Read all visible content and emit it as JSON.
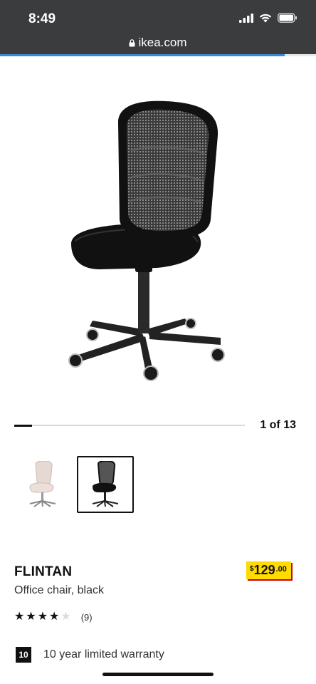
{
  "status_bar": {
    "time": "8:49",
    "icons": [
      "signal-icon",
      "wifi-icon",
      "battery-icon"
    ]
  },
  "browser": {
    "url": "ikea.com",
    "load_progress": 0.9
  },
  "carousel": {
    "position_text": "1 of 13",
    "current": 1,
    "total": 13
  },
  "thumbnails": [
    {
      "name": "beige office chair",
      "selected": false
    },
    {
      "name": "black office chair",
      "selected": true
    }
  ],
  "product": {
    "name": "FLINTAN",
    "description": "Office chair, black",
    "price": {
      "currency": "$",
      "whole": "129",
      "cents": ".00"
    },
    "rating": {
      "stars": 4,
      "max": 5,
      "review_count": "(9)"
    },
    "warranty": {
      "badge": "10",
      "text": "10 year limited warranty"
    }
  },
  "colors": {
    "status_bar_bg": "#3b3c3e",
    "price_tag_bg": "#ffdb00",
    "price_tag_shadow": "#cc0008",
    "load_bar": "#3a87d8"
  }
}
